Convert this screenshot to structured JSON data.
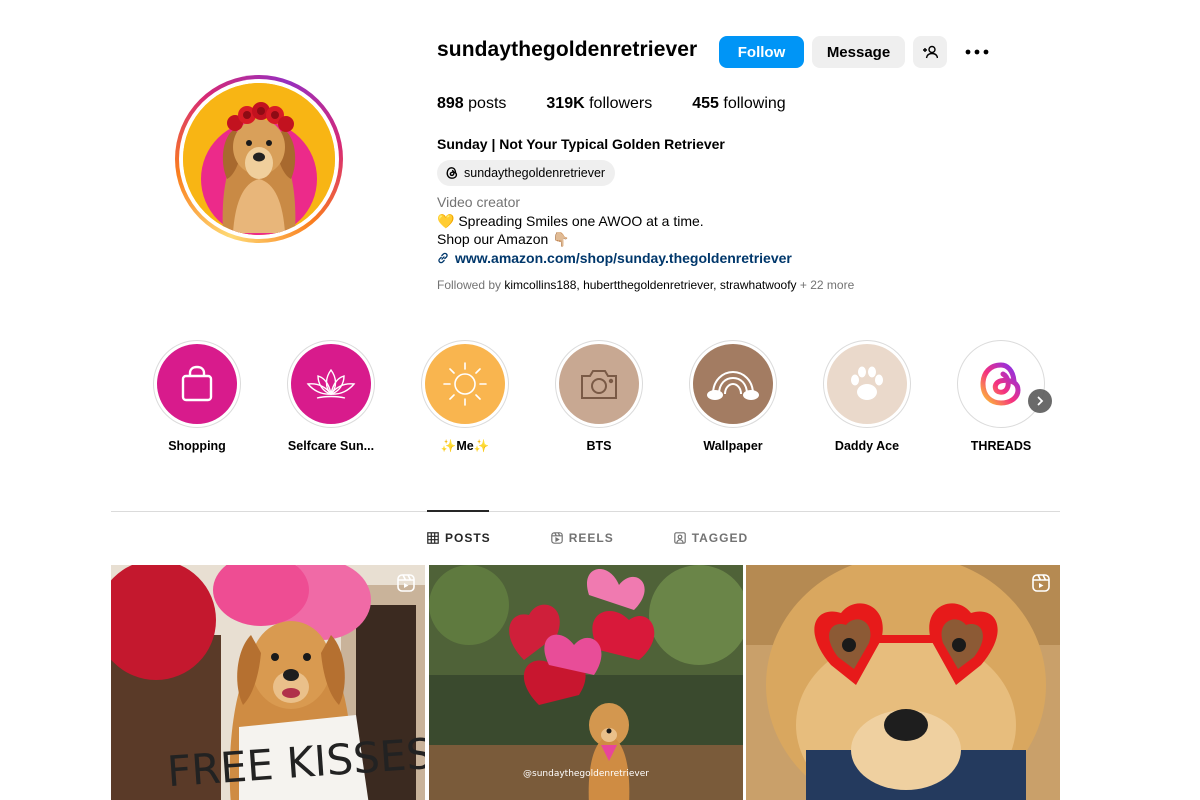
{
  "profile": {
    "username": "sundaythegoldenretriever",
    "follow_label": "Follow",
    "message_label": "Message",
    "stats": {
      "posts_count": "898",
      "posts_label": "posts",
      "followers_count": "319K",
      "followers_label": "followers",
      "following_count": "455",
      "following_label": "following"
    },
    "full_name": "Sunday | Not Your Typical Golden Retriever",
    "threads_handle": "sundaythegoldenretriever",
    "category": "Video creator",
    "bio_line1": "💛 Spreading Smiles one AWOO at a time.",
    "bio_line2": "Shop our Amazon 👇🏼",
    "link": "www.amazon.com/shop/sunday.thegoldenretriever",
    "followed_by_prefix": "Followed by ",
    "followed_by_names": [
      "kimcollins188",
      "hubertthegoldenretriever",
      "strawhatwoofy"
    ],
    "followed_by_more": " + 22 more"
  },
  "highlights": [
    {
      "label": "Shopping",
      "icon": "shopping-bag-icon",
      "color": "#d81b8c"
    },
    {
      "label": "Selfcare Sun...",
      "icon": "lotus-icon",
      "color": "#d81b8c"
    },
    {
      "label": "✨Me✨",
      "icon": "sun-icon",
      "color": "#f9b54f"
    },
    {
      "label": "BTS",
      "icon": "camera-icon",
      "color": "#c8a892"
    },
    {
      "label": "Wallpaper",
      "icon": "rainbow-icon",
      "color": "#a37c62"
    },
    {
      "label": "Daddy Ace",
      "icon": "paw-icon",
      "color": "#ead9cb"
    },
    {
      "label": "THREADS",
      "icon": "threads-icon",
      "color": "#ffffff"
    }
  ],
  "tabs": [
    {
      "label": "POSTS",
      "icon": "grid-icon",
      "active": true
    },
    {
      "label": "REELS",
      "icon": "reels-icon",
      "active": false
    },
    {
      "label": "TAGGED",
      "icon": "tagged-icon",
      "active": false
    }
  ],
  "posts": [
    {
      "sign_text": "FREE KISSES",
      "is_reel": true
    },
    {
      "watermark": "@sundaythegoldenretriever",
      "is_reel": false
    },
    {
      "is_reel": true
    }
  ],
  "colors": {
    "accent": "#0095f6",
    "link": "#00376b",
    "secondary_text": "#737373",
    "button_gray": "#efefef"
  }
}
